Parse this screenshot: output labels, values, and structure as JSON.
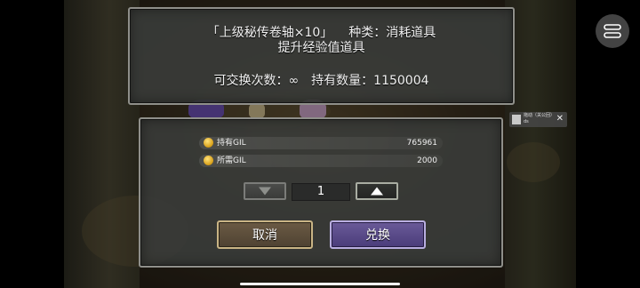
{
  "info": {
    "item_line": "「上级秘传卷轴×10」",
    "category_line": "种类：消耗道具",
    "effect_line": "提升经验值道具",
    "exchange_count_line": "可交换次数：∞",
    "held_count_line": "持有数量：1150004"
  },
  "gil": {
    "held_label": "持有GIL",
    "held_value": "765961",
    "required_label": "所需GIL",
    "required_value": "2000"
  },
  "quantity": {
    "value": "1"
  },
  "buttons": {
    "cancel_label": "取消",
    "confirm_label": "兑换"
  },
  "ad": {
    "text": "拖动（关公回）ds",
    "close": "✕"
  },
  "colors": {
    "panel_bg": "#3a3c3a",
    "panel_border": "#8f8f8a",
    "cancel_accent": "#c9b485",
    "confirm_accent": "#6a5a98",
    "coin": "#d9a21c"
  },
  "icons": {
    "coin": "gil-coin-icon",
    "decrease": "triangle-down-icon",
    "increase": "triangle-up-icon",
    "menu": "menu-icon"
  }
}
